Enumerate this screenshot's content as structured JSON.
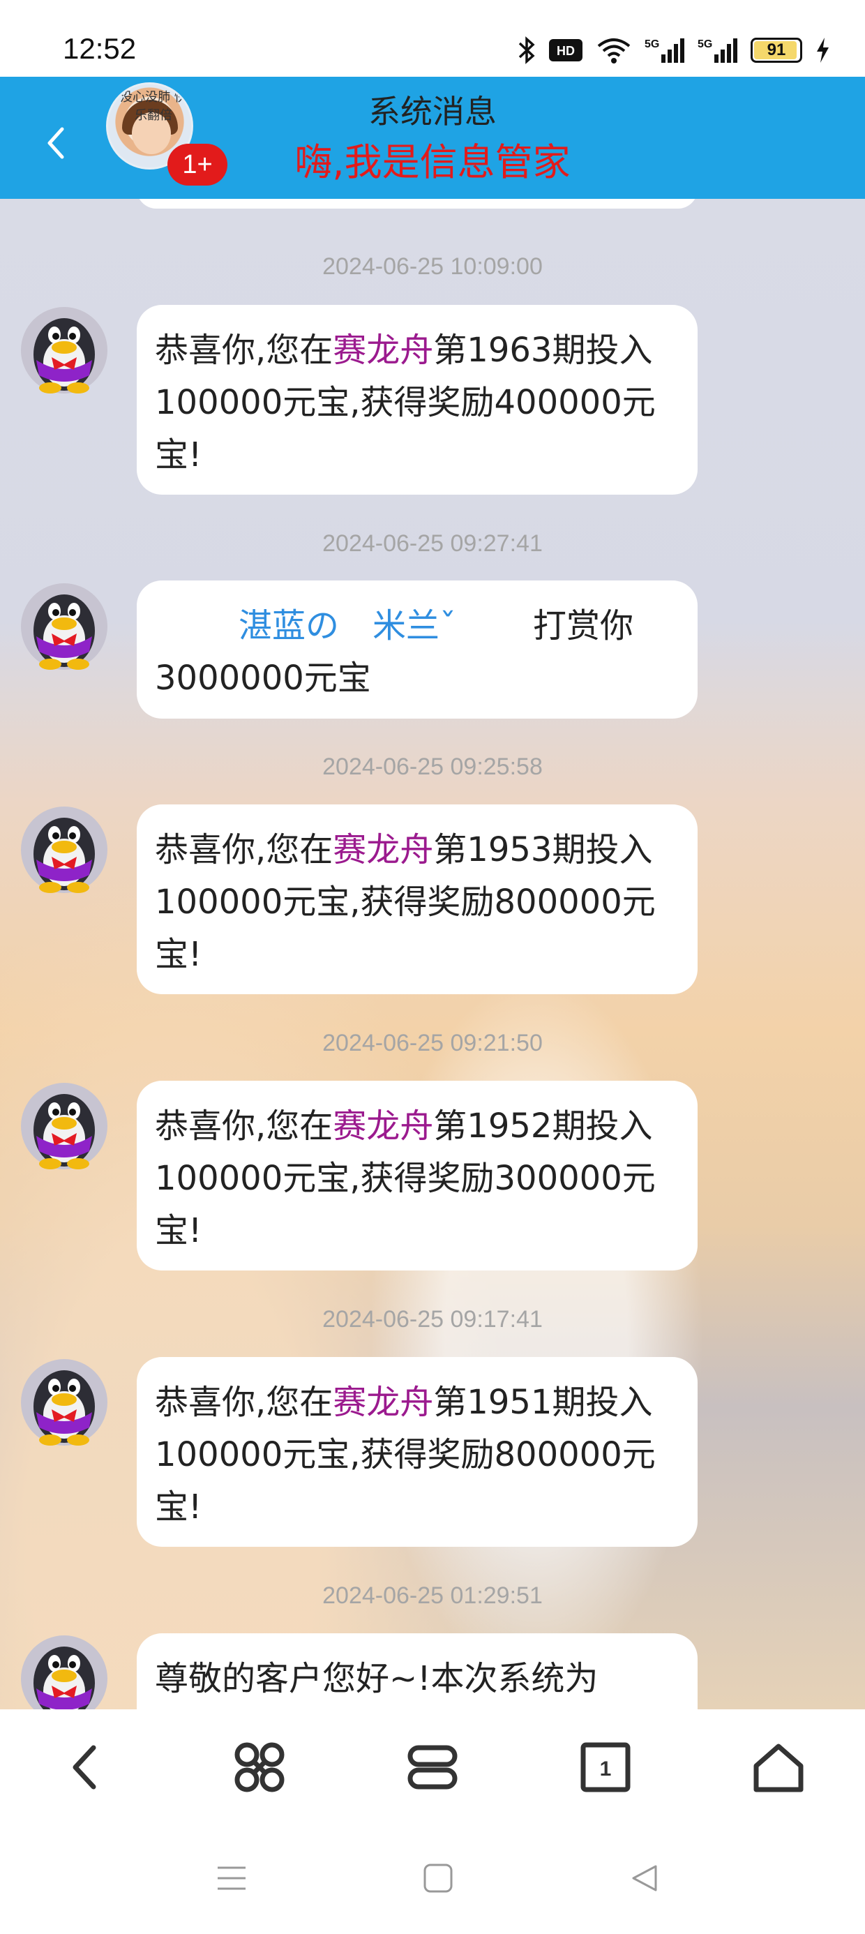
{
  "status_bar": {
    "time": "12:52",
    "battery_level": "91",
    "icons": [
      "bluetooth-icon",
      "hd-icon",
      "wifi-icon",
      "signal-5g-icon",
      "signal-5g-icon",
      "battery-icon",
      "charging-icon"
    ]
  },
  "header": {
    "title": "系统消息",
    "subtitle": "嗨,我是信息管家",
    "badge": "1+",
    "avatar_text": "没心没肺 快乐翻倍",
    "accent_color": "#1fa3e4"
  },
  "messages": [
    {
      "timestamp": "2024-06-25 10:09:00",
      "parts": [
        " 恭喜你,您在",
        "赛龙舟",
        "第1963期投入100000元宝,获得奖励400000元宝!"
      ]
    },
    {
      "timestamp": "2024-06-25 09:27:41",
      "tip_name": "湛蓝の　米兰ˇ",
      "tip_text": "打赏你3000000元宝"
    },
    {
      "timestamp": "2024-06-25 09:25:58",
      "parts": [
        " 恭喜你,您在",
        "赛龙舟",
        "第1953期投入100000元宝,获得奖励800000元宝!"
      ]
    },
    {
      "timestamp": "2024-06-25 09:21:50",
      "parts": [
        " 恭喜你,您在",
        "赛龙舟",
        "第1952期投入100000元宝,获得奖励300000元宝!"
      ]
    },
    {
      "timestamp": "2024-06-25 09:17:41",
      "parts": [
        " 恭喜你,您在",
        "赛龙舟",
        "第1951期投入100000元宝,获得奖励800000元宝!"
      ]
    },
    {
      "timestamp": "2024-06-25 01:29:51",
      "text": " 尊敬的客户您好~!本次系统为"
    }
  ],
  "toolbar": {
    "items": [
      "back-icon",
      "shortcuts-icon",
      "menu-icon",
      "tabs-icon",
      "home-icon"
    ],
    "tab_count": "1"
  },
  "navbar": {
    "items": [
      "recents-icon",
      "home-square-icon",
      "back-triangle-icon"
    ]
  }
}
